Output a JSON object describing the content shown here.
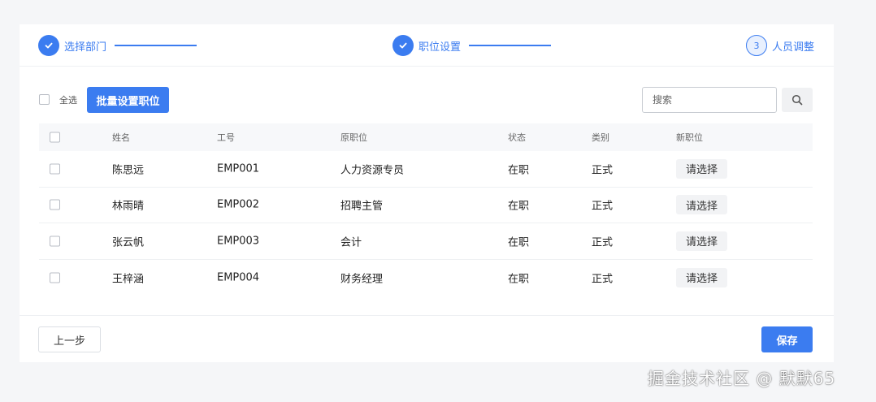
{
  "steps": [
    {
      "label": "选择部门",
      "state": "done"
    },
    {
      "label": "职位设置",
      "state": "done"
    },
    {
      "number": "3",
      "label": "人员调整",
      "state": "current"
    }
  ],
  "toolbar": {
    "select_all_label": "全选",
    "batch_button_label": "批量设置职位",
    "search_placeholder": "搜索"
  },
  "table": {
    "headers": [
      "姓名",
      "工号",
      "原职位",
      "状态",
      "类别",
      "新职位"
    ],
    "rows": [
      {
        "name": "陈思远",
        "id": "EMP001",
        "position": "人力资源专员",
        "status": "在职",
        "type": "正式",
        "new_position": "请选择"
      },
      {
        "name": "林雨晴",
        "id": "EMP002",
        "position": "招聘主管",
        "status": "在职",
        "type": "正式",
        "new_position": "请选择"
      },
      {
        "name": "张云帆",
        "id": "EMP003",
        "position": "会计",
        "status": "在职",
        "type": "正式",
        "new_position": "请选择"
      },
      {
        "name": "王梓涵",
        "id": "EMP004",
        "position": "财务经理",
        "status": "在职",
        "type": "正式",
        "new_position": "请选择"
      }
    ]
  },
  "footer": {
    "prev_label": "上一步",
    "save_label": "保存"
  },
  "watermark": "掘金技术社区 @ 默默65",
  "colors": {
    "primary": "#3b7cf0"
  }
}
